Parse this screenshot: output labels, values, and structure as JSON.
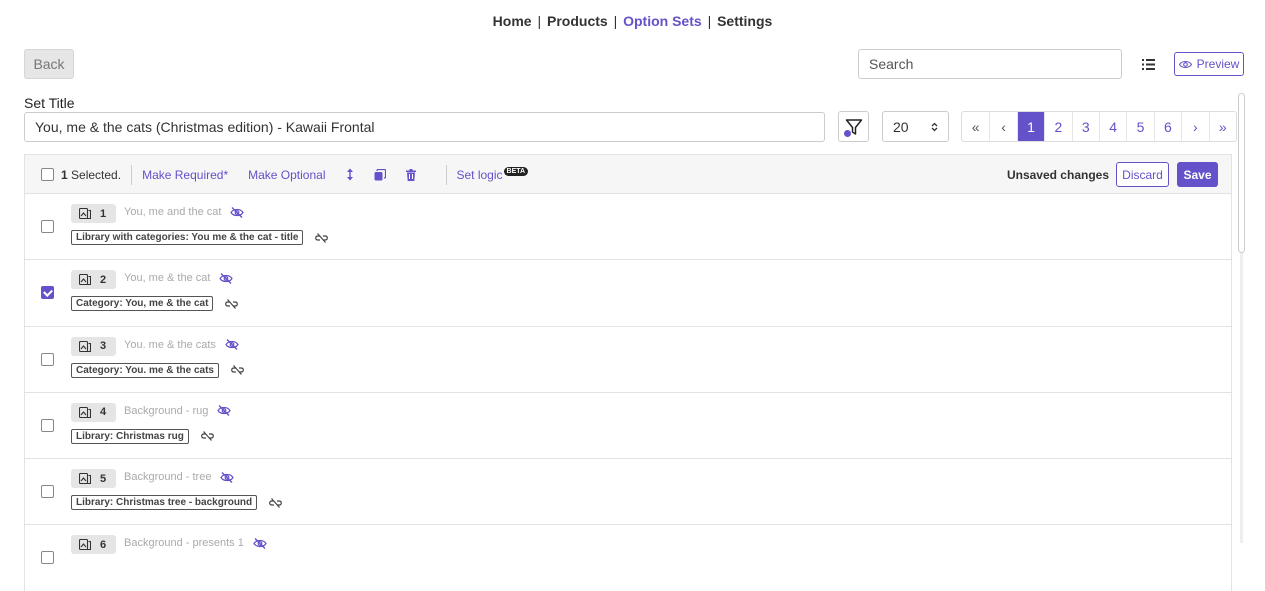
{
  "nav": {
    "home": "Home",
    "products": "Products",
    "option_sets": "Option Sets",
    "settings": "Settings",
    "sep": "|"
  },
  "back_label": "Back",
  "search": {
    "placeholder": "Search"
  },
  "preview_label": "Preview",
  "set_title_label": "Set Title",
  "set_title_value": "You, me & the cats (Christmas edition) - Kawaii Frontal",
  "per_page": "20",
  "pagination": {
    "first": "«",
    "prev": "‹",
    "next": "›",
    "last": "»",
    "pages": [
      "1",
      "2",
      "3",
      "4",
      "5",
      "6"
    ],
    "current": "1"
  },
  "toolbar": {
    "selected_count": "1",
    "selected_label": "Selected.",
    "make_required": "Make Required*",
    "make_optional": "Make Optional",
    "set_logic": "Set logic",
    "beta": "BETA",
    "unsaved": "Unsaved changes",
    "discard": "Discard",
    "save": "Save"
  },
  "rows": [
    {
      "num": "1",
      "name": "You, me and the cat",
      "tag": "Library with categories: You me & the cat - title",
      "checked": false
    },
    {
      "num": "2",
      "name": "You, me & the cat",
      "tag": "Category: You, me & the cat",
      "checked": true
    },
    {
      "num": "3",
      "name": "You. me & the cats",
      "tag": "Category: You. me & the cats",
      "checked": false
    },
    {
      "num": "4",
      "name": "Background - rug",
      "tag": "Library: Christmas rug",
      "checked": false
    },
    {
      "num": "5",
      "name": "Background - tree",
      "tag": "Library: Christmas tree - background",
      "checked": false
    },
    {
      "num": "6",
      "name": "Background - presents 1",
      "tag": "",
      "checked": false
    }
  ],
  "colors": {
    "accent": "#6352c9"
  },
  "icons": [
    "list-icon",
    "eye-icon",
    "filter-icon",
    "reorder-icon",
    "duplicate-icon",
    "trash-icon",
    "images-icon",
    "eye-off-icon",
    "unlink-icon",
    "chevron-updown-icon"
  ]
}
